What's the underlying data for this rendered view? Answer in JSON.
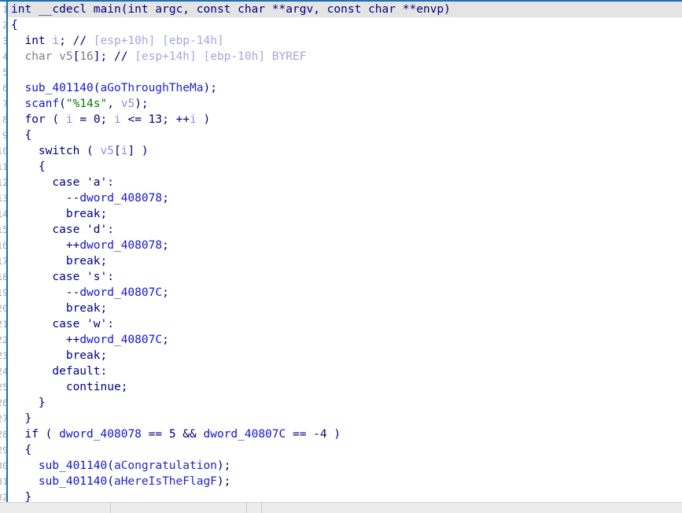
{
  "window": {
    "view": "Pseudocode",
    "background": "#ffffff",
    "accent": "#1a6fb5",
    "current_line_highlight": "#e4e4e4"
  },
  "colors": {
    "keyword": "#00007f",
    "function": "#1414d2",
    "data_symbol": "#1414d2",
    "global_string_ref": "#2424c8",
    "local_var_highlight": "#8f8fd8",
    "local_var": "#808080",
    "comment": "#a6a6dd",
    "string_literal": "#008000",
    "line_number": "#9aa6b2"
  },
  "gutter": {
    "line_numbers": [
      "1",
      "2",
      "3",
      "4",
      "5",
      "6",
      "7",
      "8",
      "9",
      "10",
      "11",
      "12",
      "13",
      "14",
      "15",
      "16",
      "17",
      "18",
      "19",
      "20",
      "21",
      "22",
      "23",
      "24",
      "25",
      "26",
      "27",
      "28",
      "29",
      "30",
      "31",
      "32"
    ]
  },
  "code": {
    "language": "c-pseudocode",
    "current_line_index": 0,
    "lines": [
      {
        "n": 1,
        "current": true,
        "tokens": [
          {
            "t": "int",
            "c": "kw"
          },
          {
            "t": " ",
            "c": "punc"
          },
          {
            "t": "__cdecl",
            "c": "kw"
          },
          {
            "t": " ",
            "c": "punc"
          },
          {
            "t": "main",
            "c": "kw"
          },
          {
            "t": "(",
            "c": "punc"
          },
          {
            "t": "int",
            "c": "kw"
          },
          {
            "t": " ",
            "c": "punc"
          },
          {
            "t": "argc",
            "c": "kw"
          },
          {
            "t": ", ",
            "c": "punc"
          },
          {
            "t": "const",
            "c": "kw"
          },
          {
            "t": " ",
            "c": "punc"
          },
          {
            "t": "char",
            "c": "kw"
          },
          {
            "t": " **",
            "c": "punc"
          },
          {
            "t": "argv",
            "c": "kw"
          },
          {
            "t": ", ",
            "c": "punc"
          },
          {
            "t": "const",
            "c": "kw"
          },
          {
            "t": " ",
            "c": "punc"
          },
          {
            "t": "char",
            "c": "kw"
          },
          {
            "t": " **",
            "c": "punc"
          },
          {
            "t": "envp",
            "c": "kw"
          },
          {
            "t": ")",
            "c": "punc"
          }
        ]
      },
      {
        "n": 2,
        "current": false,
        "tokens": [
          {
            "t": "{",
            "c": "punc"
          }
        ]
      },
      {
        "n": 3,
        "current": false,
        "tokens": [
          {
            "t": "  ",
            "c": "punc"
          },
          {
            "t": "int",
            "c": "kw"
          },
          {
            "t": " ",
            "c": "punc"
          },
          {
            "t": "i",
            "c": "var"
          },
          {
            "t": "; ",
            "c": "punc"
          },
          {
            "t": "//",
            "c": "kw"
          },
          {
            "t": " [esp+10h] [ebp-14h]",
            "c": "cmt"
          }
        ]
      },
      {
        "n": 4,
        "current": false,
        "tokens": [
          {
            "t": "  ",
            "c": "punc"
          },
          {
            "t": "char",
            "c": "type"
          },
          {
            "t": " ",
            "c": "punc"
          },
          {
            "t": "v5",
            "c": "lvar"
          },
          {
            "t": "[",
            "c": "punc"
          },
          {
            "t": "16",
            "c": "lvar"
          },
          {
            "t": "]; ",
            "c": "punc"
          },
          {
            "t": "//",
            "c": "kw"
          },
          {
            "t": " [esp+14h] [ebp-10h] BYREF",
            "c": "cmt"
          }
        ]
      },
      {
        "n": 5,
        "current": false,
        "tokens": [
          {
            "t": "",
            "c": "punc"
          }
        ]
      },
      {
        "n": 6,
        "current": false,
        "tokens": [
          {
            "t": "  ",
            "c": "punc"
          },
          {
            "t": "sub_401140",
            "c": "fn"
          },
          {
            "t": "(",
            "c": "punc"
          },
          {
            "t": "aGoThroughTheMa",
            "c": "gsym"
          },
          {
            "t": ");",
            "c": "punc"
          }
        ]
      },
      {
        "n": 7,
        "current": false,
        "tokens": [
          {
            "t": "  ",
            "c": "punc"
          },
          {
            "t": "scanf",
            "c": "fn"
          },
          {
            "t": "(",
            "c": "punc"
          },
          {
            "t": "\"%14s\"",
            "c": "str"
          },
          {
            "t": ", ",
            "c": "punc"
          },
          {
            "t": "v5",
            "c": "var"
          },
          {
            "t": ");",
            "c": "punc"
          }
        ]
      },
      {
        "n": 8,
        "current": false,
        "tokens": [
          {
            "t": "  ",
            "c": "punc"
          },
          {
            "t": "for",
            "c": "kw"
          },
          {
            "t": " ( ",
            "c": "punc"
          },
          {
            "t": "i",
            "c": "var"
          },
          {
            "t": " = ",
            "c": "punc"
          },
          {
            "t": "0",
            "c": "num"
          },
          {
            "t": "; ",
            "c": "punc"
          },
          {
            "t": "i",
            "c": "var"
          },
          {
            "t": " <= ",
            "c": "punc"
          },
          {
            "t": "13",
            "c": "num"
          },
          {
            "t": "; ++",
            "c": "punc"
          },
          {
            "t": "i",
            "c": "var"
          },
          {
            "t": " )",
            "c": "punc"
          }
        ]
      },
      {
        "n": 9,
        "current": false,
        "tokens": [
          {
            "t": "  {",
            "c": "punc"
          }
        ]
      },
      {
        "n": 10,
        "current": false,
        "tokens": [
          {
            "t": "    ",
            "c": "punc"
          },
          {
            "t": "switch",
            "c": "kw"
          },
          {
            "t": " ( ",
            "c": "punc"
          },
          {
            "t": "v5",
            "c": "var"
          },
          {
            "t": "[",
            "c": "punc"
          },
          {
            "t": "i",
            "c": "var"
          },
          {
            "t": "] )",
            "c": "punc"
          }
        ]
      },
      {
        "n": 11,
        "current": false,
        "tokens": [
          {
            "t": "    {",
            "c": "punc"
          }
        ]
      },
      {
        "n": 12,
        "current": false,
        "tokens": [
          {
            "t": "      ",
            "c": "punc"
          },
          {
            "t": "case",
            "c": "kw"
          },
          {
            "t": " ",
            "c": "punc"
          },
          {
            "t": "'a'",
            "c": "chr"
          },
          {
            "t": ":",
            "c": "punc"
          }
        ]
      },
      {
        "n": 13,
        "current": false,
        "tokens": [
          {
            "t": "        --",
            "c": "punc"
          },
          {
            "t": "dword_408078",
            "c": "sym"
          },
          {
            "t": ";",
            "c": "punc"
          }
        ]
      },
      {
        "n": 14,
        "current": false,
        "tokens": [
          {
            "t": "        ",
            "c": "punc"
          },
          {
            "t": "break",
            "c": "kw"
          },
          {
            "t": ";",
            "c": "punc"
          }
        ]
      },
      {
        "n": 15,
        "current": false,
        "tokens": [
          {
            "t": "      ",
            "c": "punc"
          },
          {
            "t": "case",
            "c": "kw"
          },
          {
            "t": " ",
            "c": "punc"
          },
          {
            "t": "'d'",
            "c": "chr"
          },
          {
            "t": ":",
            "c": "punc"
          }
        ]
      },
      {
        "n": 16,
        "current": false,
        "tokens": [
          {
            "t": "        ++",
            "c": "punc"
          },
          {
            "t": "dword_408078",
            "c": "sym"
          },
          {
            "t": ";",
            "c": "punc"
          }
        ]
      },
      {
        "n": 17,
        "current": false,
        "tokens": [
          {
            "t": "        ",
            "c": "punc"
          },
          {
            "t": "break",
            "c": "kw"
          },
          {
            "t": ";",
            "c": "punc"
          }
        ]
      },
      {
        "n": 18,
        "current": false,
        "tokens": [
          {
            "t": "      ",
            "c": "punc"
          },
          {
            "t": "case",
            "c": "kw"
          },
          {
            "t": " ",
            "c": "punc"
          },
          {
            "t": "'s'",
            "c": "chr"
          },
          {
            "t": ":",
            "c": "punc"
          }
        ]
      },
      {
        "n": 19,
        "current": false,
        "tokens": [
          {
            "t": "        --",
            "c": "punc"
          },
          {
            "t": "dword_40807C",
            "c": "sym"
          },
          {
            "t": ";",
            "c": "punc"
          }
        ]
      },
      {
        "n": 20,
        "current": false,
        "tokens": [
          {
            "t": "        ",
            "c": "punc"
          },
          {
            "t": "break",
            "c": "kw"
          },
          {
            "t": ";",
            "c": "punc"
          }
        ]
      },
      {
        "n": 21,
        "current": false,
        "tokens": [
          {
            "t": "      ",
            "c": "punc"
          },
          {
            "t": "case",
            "c": "kw"
          },
          {
            "t": " ",
            "c": "punc"
          },
          {
            "t": "'w'",
            "c": "chr"
          },
          {
            "t": ":",
            "c": "punc"
          }
        ]
      },
      {
        "n": 22,
        "current": false,
        "tokens": [
          {
            "t": "        ++",
            "c": "punc"
          },
          {
            "t": "dword_40807C",
            "c": "sym"
          },
          {
            "t": ";",
            "c": "punc"
          }
        ]
      },
      {
        "n": 23,
        "current": false,
        "tokens": [
          {
            "t": "        ",
            "c": "punc"
          },
          {
            "t": "break",
            "c": "kw"
          },
          {
            "t": ";",
            "c": "punc"
          }
        ]
      },
      {
        "n": 24,
        "current": false,
        "tokens": [
          {
            "t": "      ",
            "c": "punc"
          },
          {
            "t": "default",
            "c": "kw"
          },
          {
            "t": ":",
            "c": "punc"
          }
        ]
      },
      {
        "n": 25,
        "current": false,
        "tokens": [
          {
            "t": "        ",
            "c": "punc"
          },
          {
            "t": "continue",
            "c": "kw"
          },
          {
            "t": ";",
            "c": "punc"
          }
        ]
      },
      {
        "n": 26,
        "current": false,
        "tokens": [
          {
            "t": "    }",
            "c": "punc"
          }
        ]
      },
      {
        "n": 27,
        "current": false,
        "tokens": [
          {
            "t": "  }",
            "c": "punc"
          }
        ]
      },
      {
        "n": 28,
        "current": false,
        "tokens": [
          {
            "t": "  ",
            "c": "punc"
          },
          {
            "t": "if",
            "c": "kw"
          },
          {
            "t": " ( ",
            "c": "punc"
          },
          {
            "t": "dword_408078",
            "c": "sym"
          },
          {
            "t": " == ",
            "c": "punc"
          },
          {
            "t": "5",
            "c": "num"
          },
          {
            "t": " && ",
            "c": "punc"
          },
          {
            "t": "dword_40807C",
            "c": "sym"
          },
          {
            "t": " == ",
            "c": "punc"
          },
          {
            "t": "-4",
            "c": "num"
          },
          {
            "t": " )",
            "c": "punc"
          }
        ]
      },
      {
        "n": 29,
        "current": false,
        "tokens": [
          {
            "t": "  {",
            "c": "punc"
          }
        ]
      },
      {
        "n": 30,
        "current": false,
        "tokens": [
          {
            "t": "    ",
            "c": "punc"
          },
          {
            "t": "sub_401140",
            "c": "fn"
          },
          {
            "t": "(",
            "c": "punc"
          },
          {
            "t": "aCongratulation",
            "c": "gsym"
          },
          {
            "t": ");",
            "c": "punc"
          }
        ]
      },
      {
        "n": 31,
        "current": false,
        "tokens": [
          {
            "t": "    ",
            "c": "punc"
          },
          {
            "t": "sub_401140",
            "c": "fn"
          },
          {
            "t": "(",
            "c": "punc"
          },
          {
            "t": "aHereIsTheFlagF",
            "c": "gsym"
          },
          {
            "t": ");",
            "c": "punc"
          }
        ]
      },
      {
        "n": 32,
        "current": false,
        "tokens": [
          {
            "t": "  }",
            "c": "punc"
          }
        ]
      }
    ]
  },
  "statusbar": {
    "cells": [
      "",
      "",
      "",
      ""
    ]
  }
}
